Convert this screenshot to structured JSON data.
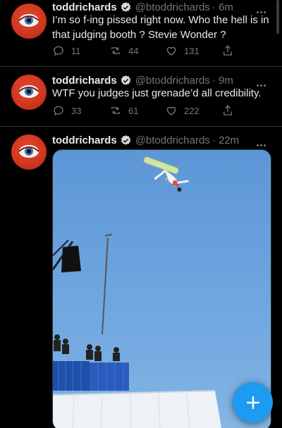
{
  "tweets": [
    {
      "name": "toddrichards",
      "handle": "@btoddrichards",
      "time": "· 6m",
      "text": "I’m so f-ing pissed right now. Who the hell is in that judging booth ? Stevie Wonder ?",
      "replies": "11",
      "retweets": "44",
      "likes": "131"
    },
    {
      "name": "toddrichards",
      "handle": "@btoddrichards",
      "time": "· 9m",
      "text": "WTF you judges just grenade’d all credibility.",
      "replies": "33",
      "retweets": "61",
      "likes": "222"
    },
    {
      "name": "toddrichards",
      "handle": "@btoddrichards",
      "time": "· 22m",
      "media": "snowboard-halfpipe-photo"
    }
  ],
  "icons": {
    "reply": "reply-icon",
    "retweet": "retweet-icon",
    "like": "heart-icon",
    "share": "share-icon",
    "verified": "verified-badge-icon",
    "more": "more-options-icon",
    "compose": "compose-plus-icon"
  },
  "colors": {
    "background": "#000000",
    "accent": "#1d9bf0",
    "muted": "#71767b",
    "text": "#e7e9ea"
  }
}
